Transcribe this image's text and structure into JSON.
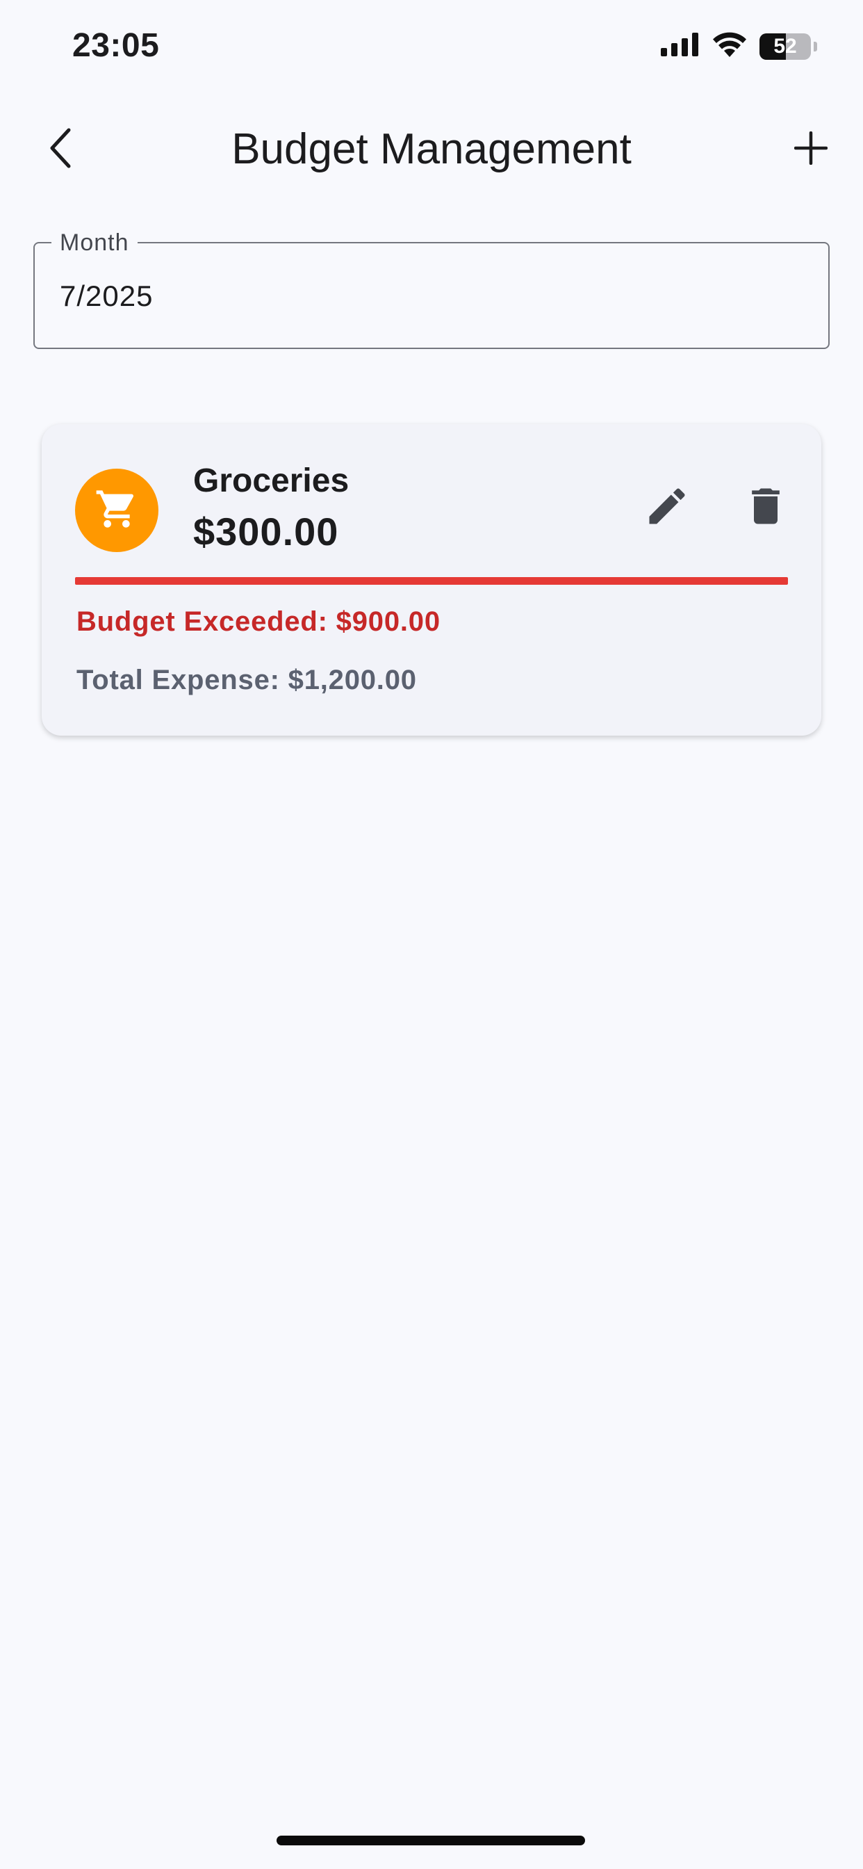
{
  "status_bar": {
    "time": "23:05",
    "battery": "52",
    "battery_level": 0.52,
    "icons": [
      "cellular-signal-icon",
      "wifi-icon",
      "battery-icon"
    ]
  },
  "app_bar": {
    "title": "Budget Management",
    "back_icon": "chevron-left-icon",
    "add_icon": "plus-icon"
  },
  "month_field": {
    "label": "Month",
    "value": "7/2025"
  },
  "budgets": [
    {
      "category": "Groceries",
      "amount": "$300.00",
      "icon": "shopping-cart-icon",
      "icon_bg": "#ff9800",
      "progress": 1.0,
      "progress_color": "#e53935",
      "status_text": "Budget Exceeded: $900.00",
      "status_color": "#c62828",
      "total_expense": "Total Expense: $1,200.00",
      "edit_icon": "pencil-icon",
      "delete_icon": "trash-icon"
    }
  ],
  "colors": {
    "background": "#f8f9fd",
    "card": "#f2f3f9",
    "accent_orange": "#ff9800",
    "danger": "#c62828"
  }
}
